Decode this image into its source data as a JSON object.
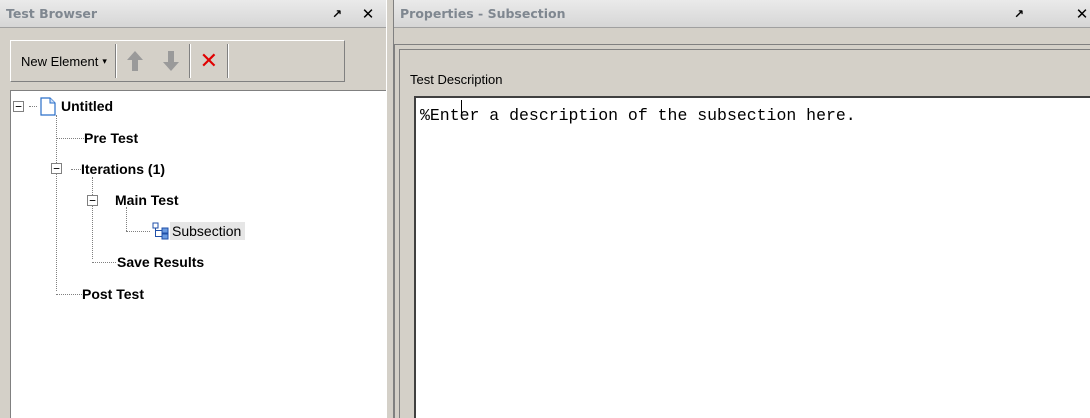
{
  "left_panel": {
    "title": "Test Browser",
    "pin_glyph": "↗",
    "close_glyph": "✕",
    "toolbar": {
      "new_element_label": "New Element",
      "caret": "▾",
      "delete_glyph": "✕"
    },
    "tree": {
      "expander_collapse": "−",
      "items": [
        {
          "label": "Untitled"
        },
        {
          "label": "Pre Test"
        },
        {
          "label": "Iterations  (1)"
        },
        {
          "label": "Main Test"
        },
        {
          "label": "Subsection"
        },
        {
          "label": "Save Results"
        },
        {
          "label": "Post Test"
        }
      ]
    }
  },
  "right_panel": {
    "title": "Properties - Subsection",
    "pin_glyph": "↗",
    "close_glyph": "✕",
    "group_label": "Test Description",
    "description_text": "%Enter a description of the subsection here."
  },
  "colors": {
    "background": "#d4d0c8",
    "title_text": "#7f8790",
    "delete_red": "#e00000",
    "arrow_gray": "#9a9a9a"
  }
}
